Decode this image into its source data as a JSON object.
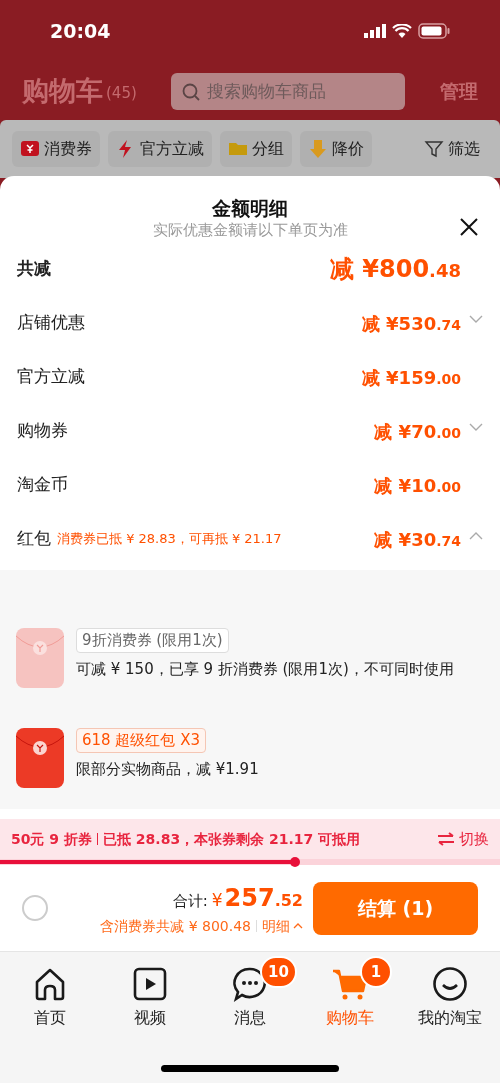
{
  "status_bar": {
    "time": "20:04"
  },
  "header": {
    "title": "购物车",
    "count": "(45)",
    "search_placeholder": "搜索购物车商品",
    "manage": "管理"
  },
  "filters": [
    {
      "kind": "coupon",
      "label": "消费券"
    },
    {
      "kind": "flash",
      "label": "官方立减"
    },
    {
      "kind": "folder",
      "label": "分组"
    },
    {
      "kind": "price_drop",
      "label": "降价"
    },
    {
      "kind": "filter",
      "label": "筛选"
    }
  ],
  "sheet": {
    "title": "金额明细",
    "subtitle": "实际优惠金额请以下单页为准",
    "rows": [
      {
        "kind": "total",
        "label": "共减",
        "amount": "减 ¥800",
        "fraction": ".48"
      },
      {
        "kind": "expandable",
        "label": "店铺优惠",
        "amount": "减 ¥530",
        "fraction": ".74",
        "expanded": false
      },
      {
        "kind": "plain",
        "label": "官方立减",
        "amount": "减 ¥159",
        "fraction": ".00"
      },
      {
        "kind": "expandable",
        "label": "购物券",
        "amount": "减 ¥70",
        "fraction": ".00",
        "expanded": false
      },
      {
        "kind": "plain",
        "label": "淘金币",
        "amount": "减 ¥10",
        "fraction": ".00"
      },
      {
        "kind": "expandable",
        "label": "红包",
        "note": "消费券已抵 ¥ 28.83，可再抵 ¥ 21.17",
        "amount": "减 ¥30",
        "fraction": ".74",
        "expanded": true
      }
    ],
    "coupons": [
      {
        "tag": "9折消费券 (限用1次)",
        "description": "可减 ¥ 150，已享 9 折消费券 (限用1次)，不可同时使用",
        "disabled": true
      },
      {
        "tag": "618 超级红包 X3",
        "description": "限部分实物商品，减 ¥1.91",
        "disabled": false
      }
    ]
  },
  "voucher_bar": {
    "name": "50元 9 折券",
    "detail": "已抵 28.83，本张券剩余 21.17 可抵用",
    "switch": "切换",
    "level": 0.59
  },
  "checkout": {
    "select_all_checked": false,
    "total_label": "合计:",
    "currency": "¥",
    "total": "257",
    "total_fraction": ".52",
    "savings": "含消费券共减 ¥ 800.48",
    "details": "明细",
    "button": "结算 (1)"
  },
  "tabbar": [
    {
      "kind": "home",
      "label": "首页",
      "selected": false
    },
    {
      "kind": "video",
      "label": "视频",
      "selected": false
    },
    {
      "kind": "message",
      "label": "消息",
      "badge": "10",
      "selected": false
    },
    {
      "kind": "cart",
      "label": "购物车",
      "badge": "1",
      "selected": true
    },
    {
      "kind": "profile",
      "label": "我的淘宝",
      "selected": false
    }
  ]
}
